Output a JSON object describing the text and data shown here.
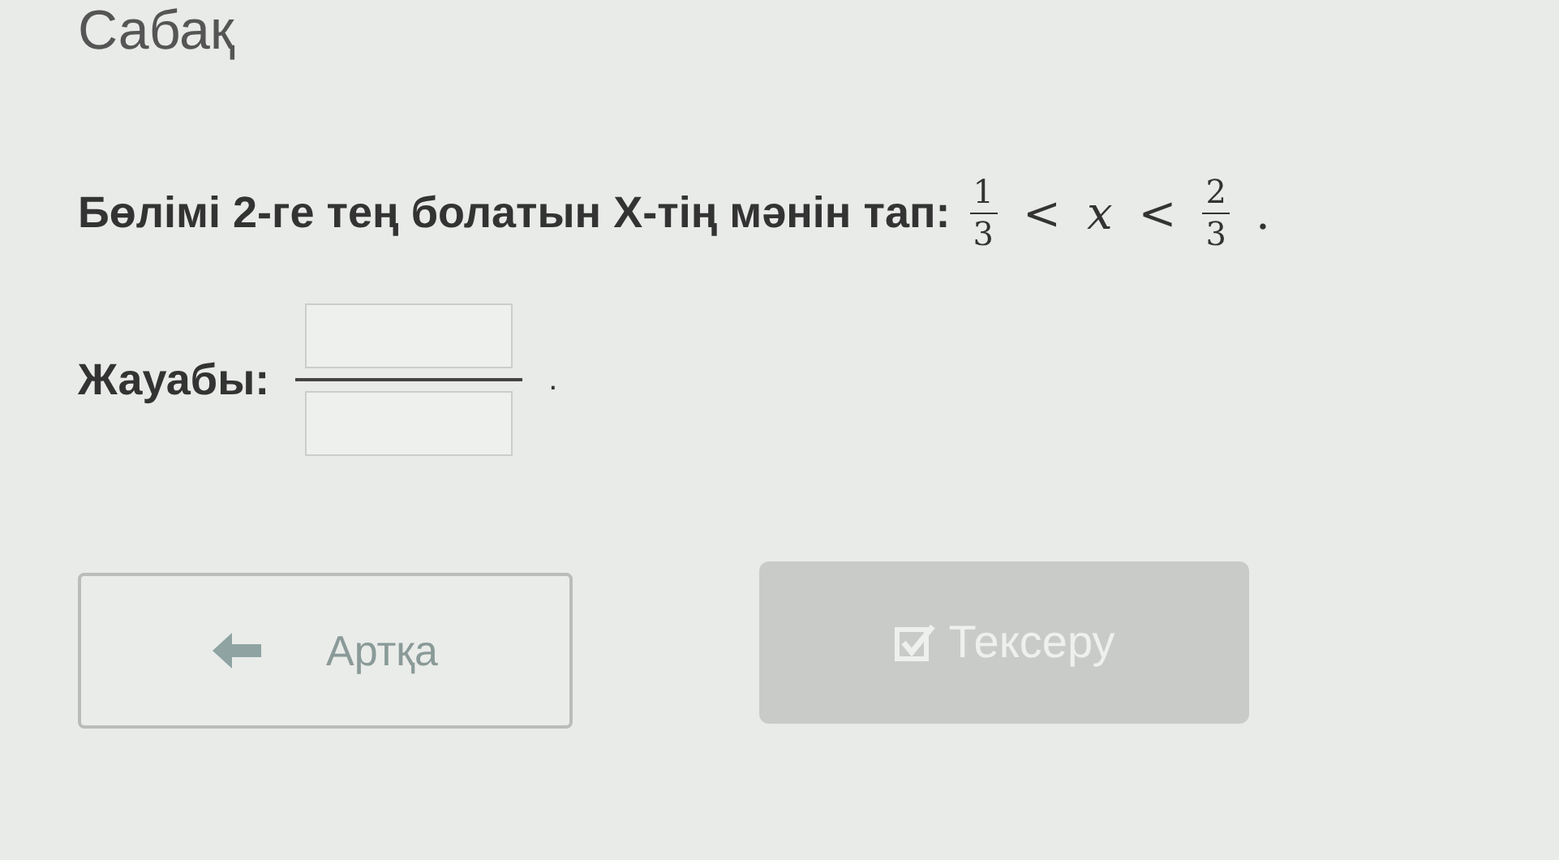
{
  "header": {
    "title": "Сабақ"
  },
  "question": {
    "text": "Бөлімі 2-ге тең болатын X-тің мәнін тап:",
    "math": [
      {
        "kind": "fraction",
        "numerator": "1",
        "denominator": "3"
      },
      {
        "kind": "symbol",
        "text": "<"
      },
      {
        "kind": "variable",
        "text": "x"
      },
      {
        "kind": "symbol",
        "text": "<"
      },
      {
        "kind": "fraction",
        "numerator": "2",
        "denominator": "3"
      },
      {
        "kind": "symbol",
        "text": "."
      }
    ]
  },
  "answer": {
    "label": "Жауабы:",
    "end": "."
  },
  "buttons": [
    {
      "kind": "back",
      "label": "Артқа",
      "disabled": false
    },
    {
      "kind": "check",
      "label": "Тексеру",
      "disabled": true
    }
  ]
}
